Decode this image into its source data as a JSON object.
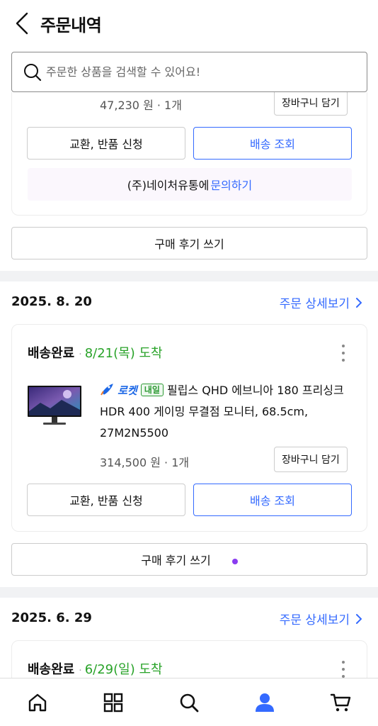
{
  "header": {
    "title": "주문내역"
  },
  "search": {
    "placeholder": "주문한 상품을 검색할 수 있어요!"
  },
  "order_top": {
    "price_qty": "47,230 원 · 1개",
    "cart_label": "장바구니 담기",
    "exchange_label": "교환, 반품 신청",
    "track_label": "배송 조회",
    "inquiry_seller": "(주)네이처유통에",
    "inquiry_link": "문의하기",
    "review_label": "구매 후기 쓰기"
  },
  "order_1": {
    "date": "2025. 8. 20",
    "detail_label": "주문 상세보기",
    "status": "배송완료",
    "arrive": "8/21(목) 도착",
    "rocket_label": "로켓",
    "tomorrow_badge": "내일",
    "product_name": "필립스 QHD 에브니아 180 프리싱크 HDR 400 게이밍 무결점 모니터, 68.5cm, 27M2N5500",
    "price_qty": "314,500 원 · 1개",
    "cart_label": "장바구니 담기",
    "exchange_label": "교환, 반품 신청",
    "track_label": "배송 조회",
    "review_label": "구매 후기 쓰기"
  },
  "order_2": {
    "date": "2025. 6. 29",
    "detail_label": "주문 상세보기",
    "status": "배송완료",
    "arrive": "6/29(일) 도착"
  },
  "colors": {
    "accent": "#346aff",
    "arrive_green": "#29a329",
    "tab_active": "#346aff",
    "tab_inactive": "#111111"
  },
  "tabbar": {
    "items": [
      {
        "icon": "home-icon",
        "active": false
      },
      {
        "icon": "categories-icon",
        "active": false
      },
      {
        "icon": "search-icon",
        "active": false
      },
      {
        "icon": "my-page-icon",
        "active": true
      },
      {
        "icon": "cart-icon",
        "active": false
      }
    ]
  }
}
